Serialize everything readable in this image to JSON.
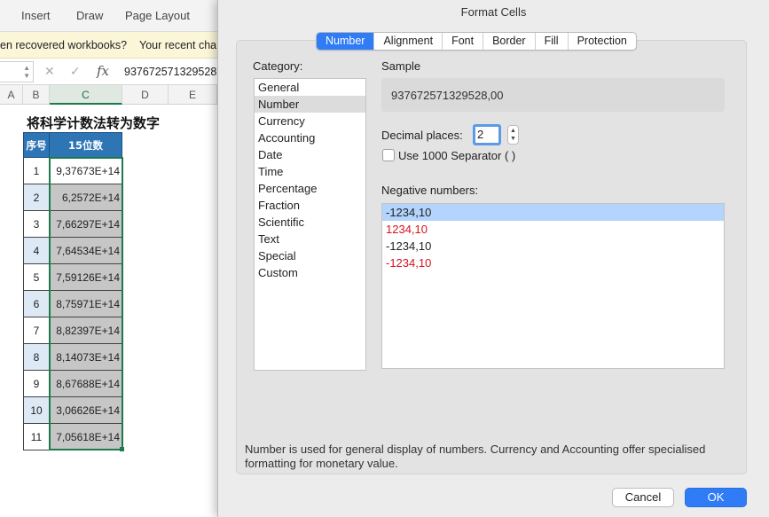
{
  "ribbon": {
    "tabs": [
      "Insert",
      "Draw",
      "Page Layout"
    ]
  },
  "banner": {
    "text": "en recovered workbooks?",
    "text2": "Your recent cha"
  },
  "formula_bar": {
    "value": "937672571329528"
  },
  "columns": [
    "A",
    "B",
    "C",
    "D",
    "E"
  ],
  "sheet": {
    "title": "将科学计数法转为数字",
    "headers": [
      "序号",
      "15位数"
    ],
    "rows": [
      {
        "idx": "1",
        "val": "9,37673E+14"
      },
      {
        "idx": "2",
        "val": "6,2572E+14"
      },
      {
        "idx": "3",
        "val": "7,66297E+14"
      },
      {
        "idx": "4",
        "val": "7,64534E+14"
      },
      {
        "idx": "5",
        "val": "7,59126E+14"
      },
      {
        "idx": "6",
        "val": "8,75971E+14"
      },
      {
        "idx": "7",
        "val": "8,82397E+14"
      },
      {
        "idx": "8",
        "val": "8,14073E+14"
      },
      {
        "idx": "9",
        "val": "8,67688E+14"
      },
      {
        "idx": "10",
        "val": "3,06626E+14"
      },
      {
        "idx": "11",
        "val": "7,05618E+14"
      }
    ]
  },
  "dialog": {
    "title": "Format Cells",
    "tabs": [
      "Number",
      "Alignment",
      "Font",
      "Border",
      "Fill",
      "Protection"
    ],
    "active_tab": "Number",
    "category_label": "Category:",
    "categories": [
      "General",
      "Number",
      "Currency",
      "Accounting",
      "Date",
      "Time",
      "Percentage",
      "Fraction",
      "Scientific",
      "Text",
      "Special",
      "Custom"
    ],
    "selected_category": "Number",
    "sample_label": "Sample",
    "sample_value": "937672571329528,00",
    "decimal_label": "Decimal places:",
    "decimal_value": "2",
    "separator_label": "Use 1000 Separator ( )",
    "negative_label": "Negative numbers:",
    "negative_options": [
      "-1234,10",
      "1234,10",
      "-1234,10",
      "-1234,10"
    ],
    "description": "Number is used for general display of numbers.  Currency and Accounting offer specialised formatting for monetary value.",
    "cancel_label": "Cancel",
    "ok_label": "OK",
    "colors": {
      "accent": "#2f7cf6",
      "negative_red": "#d8121f",
      "selection_blue": "#b3d4fd"
    }
  }
}
